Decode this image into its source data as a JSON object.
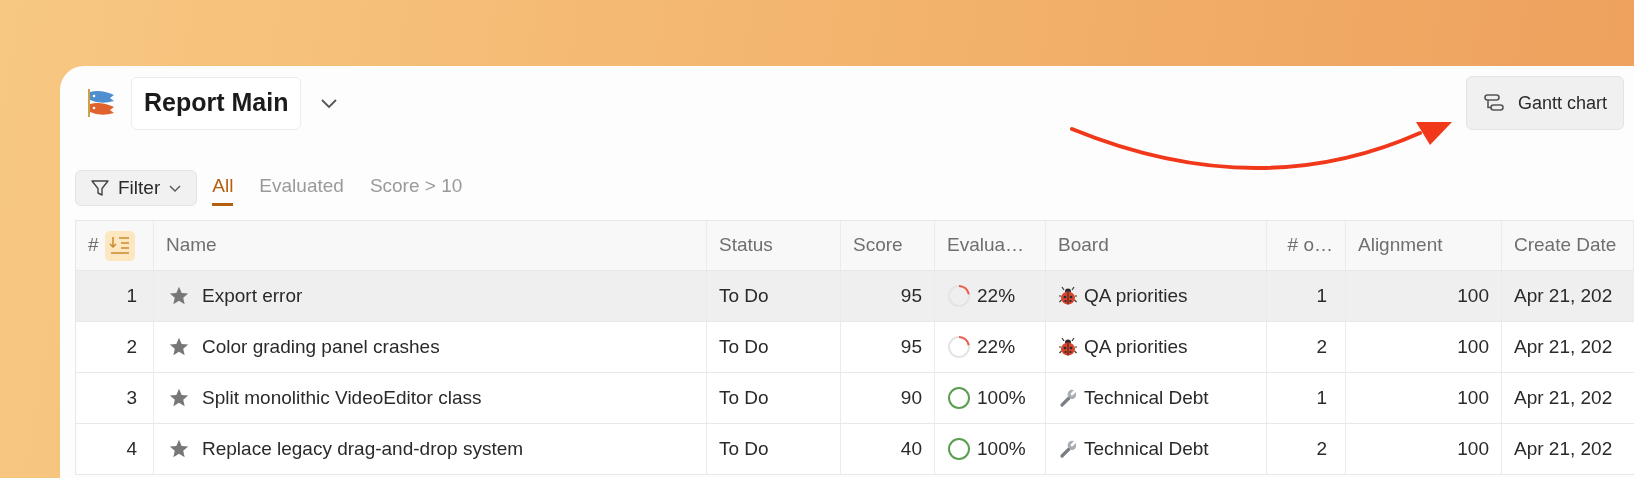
{
  "header": {
    "title": "Report Main"
  },
  "actions": [
    {
      "label": "Gantt chart"
    }
  ],
  "filter": {
    "label": "Filter"
  },
  "views": [
    {
      "label": "All",
      "selected": true
    },
    {
      "label": "Evaluated",
      "selected": false
    },
    {
      "label": "Score > 10",
      "selected": false
    }
  ],
  "table": {
    "columns": [
      {
        "label": "#"
      },
      {
        "label": "Name"
      },
      {
        "label": "Status"
      },
      {
        "label": "Score"
      },
      {
        "label": "Evalua…"
      },
      {
        "label": "Board"
      },
      {
        "label": "# o…"
      },
      {
        "label": "Alignment"
      },
      {
        "label": "Create Date"
      }
    ],
    "rows": [
      {
        "number": "1",
        "name": "Export error",
        "status": "To Do",
        "score": "95",
        "evaluated": {
          "level": 0.22,
          "reading": "22%"
        },
        "board": {
          "kind": "bug",
          "label": "QA priorities"
        },
        "count": "1",
        "alignment": "100",
        "create_date": "Apr 21, 202",
        "selected": true
      },
      {
        "number": "2",
        "name": "Color grading panel crashes",
        "status": "To Do",
        "score": "95",
        "evaluated": {
          "level": 0.22,
          "reading": "22%"
        },
        "board": {
          "kind": "bug",
          "label": "QA priorities"
        },
        "count": "2",
        "alignment": "100",
        "create_date": "Apr 21, 202",
        "selected": false
      },
      {
        "number": "3",
        "name": "Split monolithic VideoEditor class",
        "status": "To Do",
        "score": "90",
        "evaluated": {
          "level": 1,
          "reading": "100%"
        },
        "board": {
          "kind": "wrench",
          "label": "Technical Debt"
        },
        "count": "1",
        "alignment": "100",
        "create_date": "Apr 21, 202",
        "selected": false
      },
      {
        "number": "4",
        "name": "Replace legacy drag-and-drop system",
        "status": "To Do",
        "score": "40",
        "evaluated": {
          "level": 1,
          "reading": "100%"
        },
        "board": {
          "kind": "wrench",
          "label": "Technical Debt"
        },
        "count": "2",
        "alignment": "100",
        "create_date": "Apr 21, 202",
        "selected": false
      }
    ]
  }
}
